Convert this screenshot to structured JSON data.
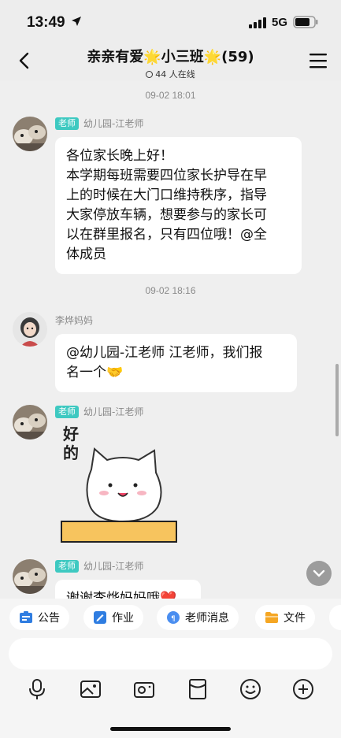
{
  "status": {
    "time": "13:49",
    "network": "5G"
  },
  "header": {
    "title_part1": "亲亲有爱",
    "star": "🌟",
    "title_part2": "小三班",
    "title_count": "(59)",
    "online": "44 人在线"
  },
  "messages": [
    {
      "timestamp": "09-02 18:01"
    },
    {
      "badge": "老师",
      "sender": "幼儿园-江老师",
      "lines": [
        "各位家长晚上好！",
        "本学期每班需要四位家长护导在早",
        "上的时候在大门口维持秩序，指导",
        "大家停放车辆，想要参与的家长可",
        "以在群里报名，只有四位哦！@全",
        "体成员"
      ]
    },
    {
      "timestamp": "09-02 18:16"
    },
    {
      "sender": "李烨妈妈",
      "lines": [
        "@幼儿园-江老师 江老师，我们报",
        "名一个🤝"
      ]
    },
    {
      "badge": "老师",
      "sender": "幼儿园-江老师",
      "sticker_text": "好的"
    },
    {
      "badge": "老师",
      "sender": "幼儿园-江老师",
      "text": "谢谢李烨妈妈哦❤️"
    }
  ],
  "quickbar": [
    {
      "label": "公告",
      "icon": "announcement-icon"
    },
    {
      "label": "作业",
      "icon": "homework-icon"
    },
    {
      "label": "老师消息",
      "icon": "teacher-message-icon"
    },
    {
      "label": "文件",
      "icon": "folder-icon"
    }
  ],
  "toolbar": [
    "microphone-icon",
    "image-icon",
    "camera-icon",
    "red-packet-icon",
    "emoji-icon",
    "plus-icon"
  ],
  "colors": {
    "badge": "#3ec9c1",
    "background": "#efefef",
    "bubble": "#ffffff"
  }
}
